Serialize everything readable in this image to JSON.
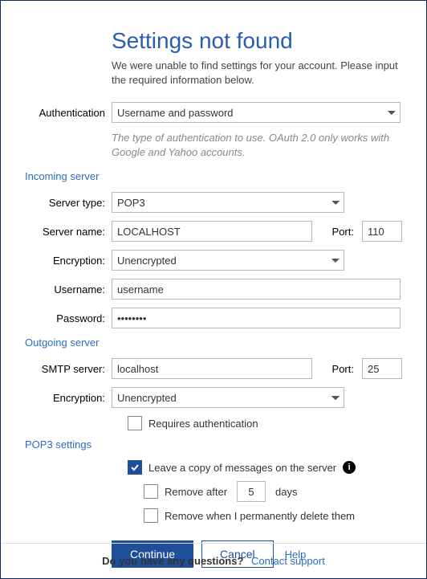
{
  "title": "Settings not found",
  "intro": "We were unable to find settings for your account. Please input the required information below.",
  "auth": {
    "label": "Authentication",
    "value": "Username and password",
    "helper": "The type of authentication to use. OAuth 2.0 only works with Google and Yahoo accounts."
  },
  "incoming": {
    "header": "Incoming server",
    "server_type_label": "Server type:",
    "server_type_value": "POP3",
    "server_name_label": "Server name:",
    "server_name_value": "LOCALHOST",
    "port_label": "Port:",
    "port_value": "110",
    "encryption_label": "Encryption:",
    "encryption_value": "Unencrypted",
    "username_label": "Username:",
    "username_value": "username",
    "password_label": "Password:",
    "password_value": "••••••••"
  },
  "outgoing": {
    "header": "Outgoing server",
    "smtp_label": "SMTP server:",
    "smtp_value": "localhost",
    "port_label": "Port:",
    "port_value": "25",
    "encryption_label": "Encryption:",
    "encryption_value": "Unencrypted",
    "requires_auth_label": "Requires authentication",
    "requires_auth_checked": false
  },
  "pop3": {
    "header": "POP3 settings",
    "leave_copy_label": "Leave a copy of messages on the server",
    "leave_copy_checked": true,
    "remove_after_prefix": "Remove after",
    "remove_after_days": "5",
    "remove_after_suffix": "days",
    "remove_perm_label": "Remove when I permanently delete them"
  },
  "buttons": {
    "continue": "Continue",
    "cancel": "Cancel",
    "help": "Help"
  },
  "footer": {
    "question": "Do you have any questions?",
    "link": "Contact support"
  }
}
